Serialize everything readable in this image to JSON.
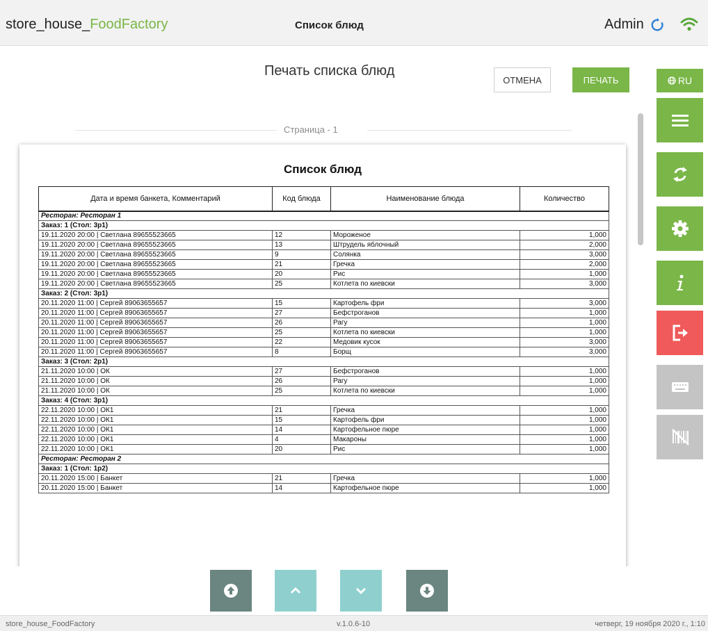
{
  "header": {
    "app_name_prefix": "store_house_",
    "app_name_accent": "FoodFactory",
    "screen_title": "Список блюд",
    "user": "Admin"
  },
  "dialog": {
    "title": "Печать списка блюд",
    "cancel_label": "ОТМЕНА",
    "print_label": "ПЕЧАТЬ",
    "page_label": "Страница - 1"
  },
  "report": {
    "title": "Список блюд",
    "columns": [
      "Дата и время банкета, Комментарий",
      "Код блюда",
      "Наименование блюда",
      "Количество"
    ],
    "rows": [
      {
        "kind": "restaurant",
        "text": "Ресторан: Ресторан 1"
      },
      {
        "kind": "group",
        "text": "Заказ: 1 (Стол: 3р1)"
      },
      {
        "kind": "item",
        "cells": [
          "19.11.2020 20:00 | Светлана 89655523665",
          "12",
          "Мороженое",
          "1,000"
        ]
      },
      {
        "kind": "item",
        "cells": [
          "19.11.2020 20:00 | Светлана 89655523665",
          "13",
          "Штрудель яблочный",
          "2,000"
        ]
      },
      {
        "kind": "item",
        "cells": [
          "19.11.2020 20:00 | Светлана 89655523665",
          "9",
          "Солянка",
          "3,000"
        ]
      },
      {
        "kind": "item",
        "cells": [
          "19.11.2020 20:00 | Светлана 89655523665",
          "21",
          "Гречка",
          "2,000"
        ]
      },
      {
        "kind": "item",
        "cells": [
          "19.11.2020 20:00 | Светлана 89655523665",
          "20",
          "Рис",
          "1,000"
        ]
      },
      {
        "kind": "item",
        "cells": [
          "19.11.2020 20:00 | Светлана 89655523665",
          "25",
          "Котлета по киевски",
          "3,000"
        ]
      },
      {
        "kind": "group",
        "text": "Заказ: 2 (Стол: 3р1)"
      },
      {
        "kind": "item",
        "cells": [
          "20.11.2020 11:00 | Сергей 89063655657",
          "15",
          "Картофель фри",
          "3,000"
        ]
      },
      {
        "kind": "item",
        "cells": [
          "20.11.2020 11:00 | Сергей 89063655657",
          "27",
          "Бефстроганов",
          "1,000"
        ]
      },
      {
        "kind": "item",
        "cells": [
          "20.11.2020 11:00 | Сергей 89063655657",
          "26",
          "Рагу",
          "1,000"
        ]
      },
      {
        "kind": "item",
        "cells": [
          "20.11.2020 11:00 | Сергей 89063655657",
          "25",
          "Котлета по киевски",
          "1,000"
        ]
      },
      {
        "kind": "item",
        "cells": [
          "20.11.2020 11:00 | Сергей 89063655657",
          "22",
          "Медовик кусок",
          "3,000"
        ]
      },
      {
        "kind": "item",
        "cells": [
          "20.11.2020 11:00 | Сергей 89063655657",
          "8",
          "Борщ",
          "3,000"
        ]
      },
      {
        "kind": "group",
        "text": "Заказ: 3 (Стол: 2р1)"
      },
      {
        "kind": "item",
        "cells": [
          "21.11.2020 10:00 | ОК",
          "27",
          "Бефстроганов",
          "1,000"
        ]
      },
      {
        "kind": "item",
        "cells": [
          "21.11.2020 10:00 | ОК",
          "26",
          "Рагу",
          "1,000"
        ]
      },
      {
        "kind": "item",
        "cells": [
          "21.11.2020 10:00 | ОК",
          "25",
          "Котлета по киевски",
          "1,000"
        ]
      },
      {
        "kind": "group",
        "text": "Заказ: 4 (Стол: 3р1)"
      },
      {
        "kind": "item",
        "cells": [
          "22.11.2020 10:00 | ОК1",
          "21",
          "Гречка",
          "1,000"
        ]
      },
      {
        "kind": "item",
        "cells": [
          "22.11.2020 10:00 | ОК1",
          "15",
          "Картофель фри",
          "1,000"
        ]
      },
      {
        "kind": "item",
        "cells": [
          "22.11.2020 10:00 | ОК1",
          "14",
          "Картофельное пюре",
          "1,000"
        ]
      },
      {
        "kind": "item",
        "cells": [
          "22.11.2020 10:00 | ОК1",
          "4",
          "Макароны",
          "1,000"
        ]
      },
      {
        "kind": "item",
        "cells": [
          "22.11.2020 10:00 | ОК1",
          "20",
          "Рис",
          "1,000"
        ]
      },
      {
        "kind": "restaurant",
        "text": "Ресторан: Ресторан 2"
      },
      {
        "kind": "group",
        "text": "Заказ: 1 (Стол: 1р2)"
      },
      {
        "kind": "item",
        "cells": [
          "20.11.2020 15:00 | Банкет",
          "21",
          "Гречка",
          "1,000"
        ]
      },
      {
        "kind": "item",
        "cells": [
          "20.11.2020 15:00 | Банкет",
          "14",
          "Картофельное пюре",
          "1,000"
        ]
      }
    ]
  },
  "sidebar": {
    "lang_label": "RU",
    "buttons": [
      {
        "icon": "menu-icon",
        "color": "#7ab648"
      },
      {
        "icon": "sync-icon",
        "color": "#7ab648"
      },
      {
        "icon": "settings-icon",
        "color": "#7ab648"
      },
      {
        "icon": "info-icon",
        "color": "#7ab648"
      },
      {
        "icon": "logout-icon",
        "color": "#f05a5a"
      },
      {
        "icon": "keyboard-icon",
        "color": "#c4c4c4"
      },
      {
        "icon": "barcode-off-icon",
        "color": "#c4c4c4"
      }
    ]
  },
  "footer": {
    "app_name": "store_house_FoodFactory",
    "version": "v.1.0.6-10",
    "datetime": "четверг, 19 ноября 2020 г., 1:10"
  },
  "colors": {
    "accent_green": "#7ab648",
    "danger_red": "#f05a5a",
    "disabled_grey": "#c4c4c4",
    "nav_dark": "#6b8580",
    "nav_light": "#8fd0ce"
  }
}
